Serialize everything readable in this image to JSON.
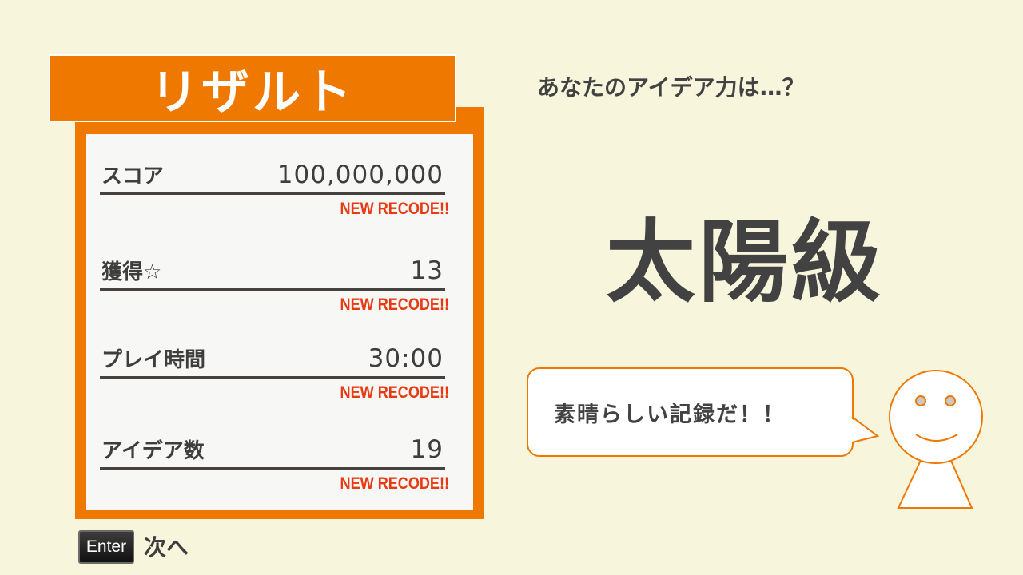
{
  "title": "リザルト",
  "results": [
    {
      "label": "スコア",
      "value": "100,000,000",
      "record": "NEW RECODE!!"
    },
    {
      "label": "獲得☆",
      "value": "13",
      "record": "NEW RECODE!!"
    },
    {
      "label": "プレイ時間",
      "value": "30:00",
      "record": "NEW RECODE!!"
    },
    {
      "label": "アイデア数",
      "value": "19",
      "record": "NEW RECODE!!"
    }
  ],
  "footer": {
    "key_label": "Enter",
    "next_label": "次へ"
  },
  "question": "あなたのアイデア力は…？",
  "rank": "太陽級",
  "speech": "素晴らしい記録だ！！",
  "colors": {
    "accent": "#ee7800",
    "background": "#f8f5dd",
    "record": "#e83a12",
    "text": "#424242"
  },
  "icons": {
    "mascot": "smiley-character-icon"
  }
}
